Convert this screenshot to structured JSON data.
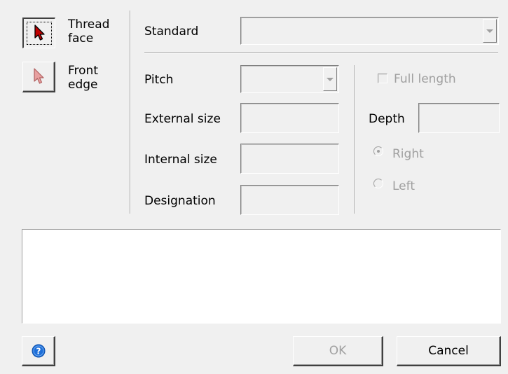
{
  "tools": {
    "thread_face": {
      "line1": "Thread",
      "line2": "face",
      "icon": "cursor-arrow-icon",
      "color": "#c00000"
    },
    "front_edge": {
      "line1": "Front",
      "line2": "edge",
      "icon": "cursor-arrow-icon",
      "color": "#e6a0a0"
    }
  },
  "form": {
    "standard_label": "Standard",
    "standard_value": "",
    "pitch_label": "Pitch",
    "pitch_value": "",
    "external_size_label": "External size",
    "external_size_value": "",
    "internal_size_label": "Internal size",
    "internal_size_value": "",
    "designation_label": "Designation",
    "designation_value": ""
  },
  "options": {
    "full_length_label": "Full length",
    "full_length_checked": false,
    "depth_label": "Depth",
    "depth_value": "",
    "direction_right_label": "Right",
    "direction_left_label": "Left",
    "direction_selected": "Right"
  },
  "notes_text": "",
  "footer": {
    "help_icon": "help-icon",
    "help_color": "#1e6fd9",
    "ok_label": "OK",
    "cancel_label": "Cancel"
  }
}
